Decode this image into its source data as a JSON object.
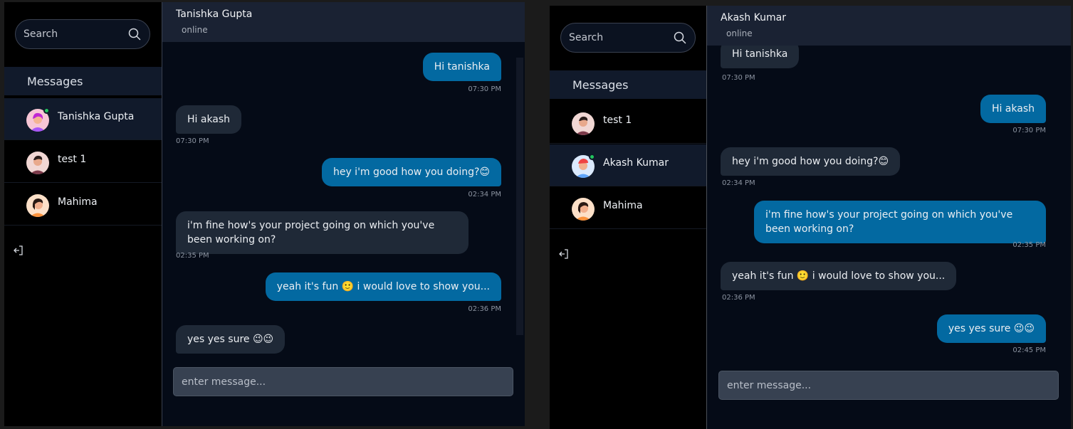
{
  "left": {
    "search": {
      "placeholder": "Search"
    },
    "sidebar_title": "Messages",
    "conversations": [
      {
        "name": "Tanishka Gupta",
        "active": true,
        "online": true
      },
      {
        "name": "test 1",
        "active": false,
        "online": false
      },
      {
        "name": "Mahima",
        "active": false,
        "online": false
      }
    ],
    "chat": {
      "title": "Tanishka Gupta",
      "status": "online",
      "messages": [
        {
          "dir": "out",
          "text": "Hi tanishka",
          "time": "07:30 PM"
        },
        {
          "dir": "in",
          "text": "Hi akash",
          "time": "07:30 PM"
        },
        {
          "dir": "out",
          "text": "hey i'm good how you doing?😊",
          "time": "02:34 PM"
        },
        {
          "dir": "in",
          "text": "i'm fine how's your project going on which you've been working on?",
          "time": "02:35 PM"
        },
        {
          "dir": "out",
          "text": "yeah it's fun 🙂 i would love to show you...",
          "time": "02:36 PM"
        },
        {
          "dir": "in",
          "text": "yes yes sure 😉😉",
          "time": ""
        }
      ],
      "composer_placeholder": "enter message..."
    }
  },
  "right": {
    "search": {
      "placeholder": "Search"
    },
    "sidebar_title": "Messages",
    "conversations": [
      {
        "name": "test 1",
        "active": false,
        "online": false
      },
      {
        "name": "Akash Kumar",
        "active": true,
        "online": true
      },
      {
        "name": "Mahima",
        "active": false,
        "online": false
      }
    ],
    "chat": {
      "title": "Akash Kumar",
      "status": "online",
      "messages": [
        {
          "dir": "in",
          "text": "Hi tanishka",
          "time": "07:30 PM"
        },
        {
          "dir": "out",
          "text": "Hi akash",
          "time": "07:30 PM"
        },
        {
          "dir": "in",
          "text": "hey i'm good how you doing?😊",
          "time": "02:34 PM"
        },
        {
          "dir": "out",
          "text": "i'm fine how's your project going on which you've been working on?",
          "time": "02:35 PM"
        },
        {
          "dir": "in",
          "text": "yeah it's fun 🙂 i would love to show you...",
          "time": "02:36 PM"
        },
        {
          "dir": "out",
          "text": "yes yes sure 😉😉",
          "time": "02:45 PM"
        }
      ],
      "composer_placeholder": "enter message..."
    }
  },
  "icons": {
    "search": "search-icon",
    "logout": "logout-icon"
  },
  "colors": {
    "outgoing_bubble": "#0369a1",
    "incoming_bubble": "#1f2937",
    "online_dot": "#22c55e",
    "chat_bg": "#050b17"
  }
}
